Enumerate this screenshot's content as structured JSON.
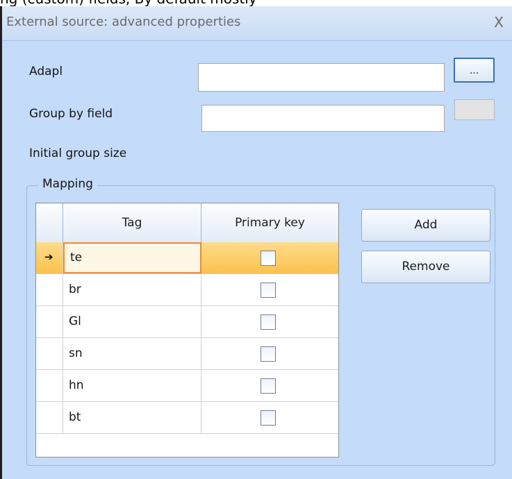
{
  "background_window": {
    "partial_title": "ng (custom) fields, By default mostly"
  },
  "dialog": {
    "title": "External source: advanced properties",
    "close_glyph": "X"
  },
  "form": {
    "adapl_label": "Adapl",
    "adapl_value": "",
    "browse_label": "...",
    "group_by_label": "Group by field",
    "group_by_value": "",
    "initial_group_size_label": "Initial group size"
  },
  "mapping": {
    "legend": "Mapping",
    "columns": {
      "tag": "Tag",
      "primary_key": "Primary key"
    },
    "rows": [
      {
        "tag": "te",
        "primary_key": false,
        "selected": true
      },
      {
        "tag": "br",
        "primary_key": false,
        "selected": false
      },
      {
        "tag": "Gl",
        "primary_key": false,
        "selected": false
      },
      {
        "tag": "sn",
        "primary_key": false,
        "selected": false
      },
      {
        "tag": "hn",
        "primary_key": false,
        "selected": false
      },
      {
        "tag": "bt",
        "primary_key": false,
        "selected": false
      }
    ],
    "add_label": "Add",
    "remove_label": "Remove"
  },
  "colors": {
    "dialog_background": "#c4dbf9",
    "selected_row": "#fbc24f",
    "focus_border": "#e98b3a"
  }
}
